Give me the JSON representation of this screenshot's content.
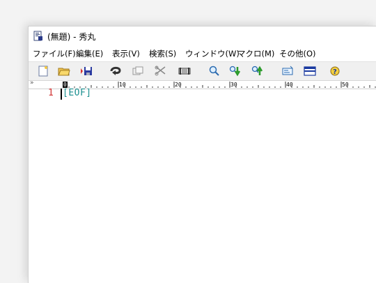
{
  "window": {
    "title": "(無題) - 秀丸"
  },
  "menu": [
    {
      "label": "ファイル(F)"
    },
    {
      "label": "編集(E)"
    },
    {
      "label": "表示(V)"
    },
    {
      "label": "検索(S)"
    },
    {
      "label": "ウィンドウ(W)"
    },
    {
      "label": "マクロ(M)"
    },
    {
      "label": "その他(O)"
    }
  ],
  "toolbar": {
    "icons": [
      "new-file-icon",
      "open-folder-icon",
      "save-icon",
      "undo-icon",
      "copy-icon",
      "cut-icon",
      "paste-icon",
      "search-icon",
      "search-down-icon",
      "search-up-icon",
      "grep-icon",
      "split-window-icon",
      "help-icon"
    ]
  },
  "ruler": {
    "labels": [
      "0",
      "10",
      "20",
      "30",
      "40",
      "50"
    ],
    "gutter_mark": "»"
  },
  "editor": {
    "line_number": "1",
    "eof_marker": "[EOF]"
  },
  "colors": {
    "line_number": "#d03030",
    "eof": "#1a8f8f"
  }
}
